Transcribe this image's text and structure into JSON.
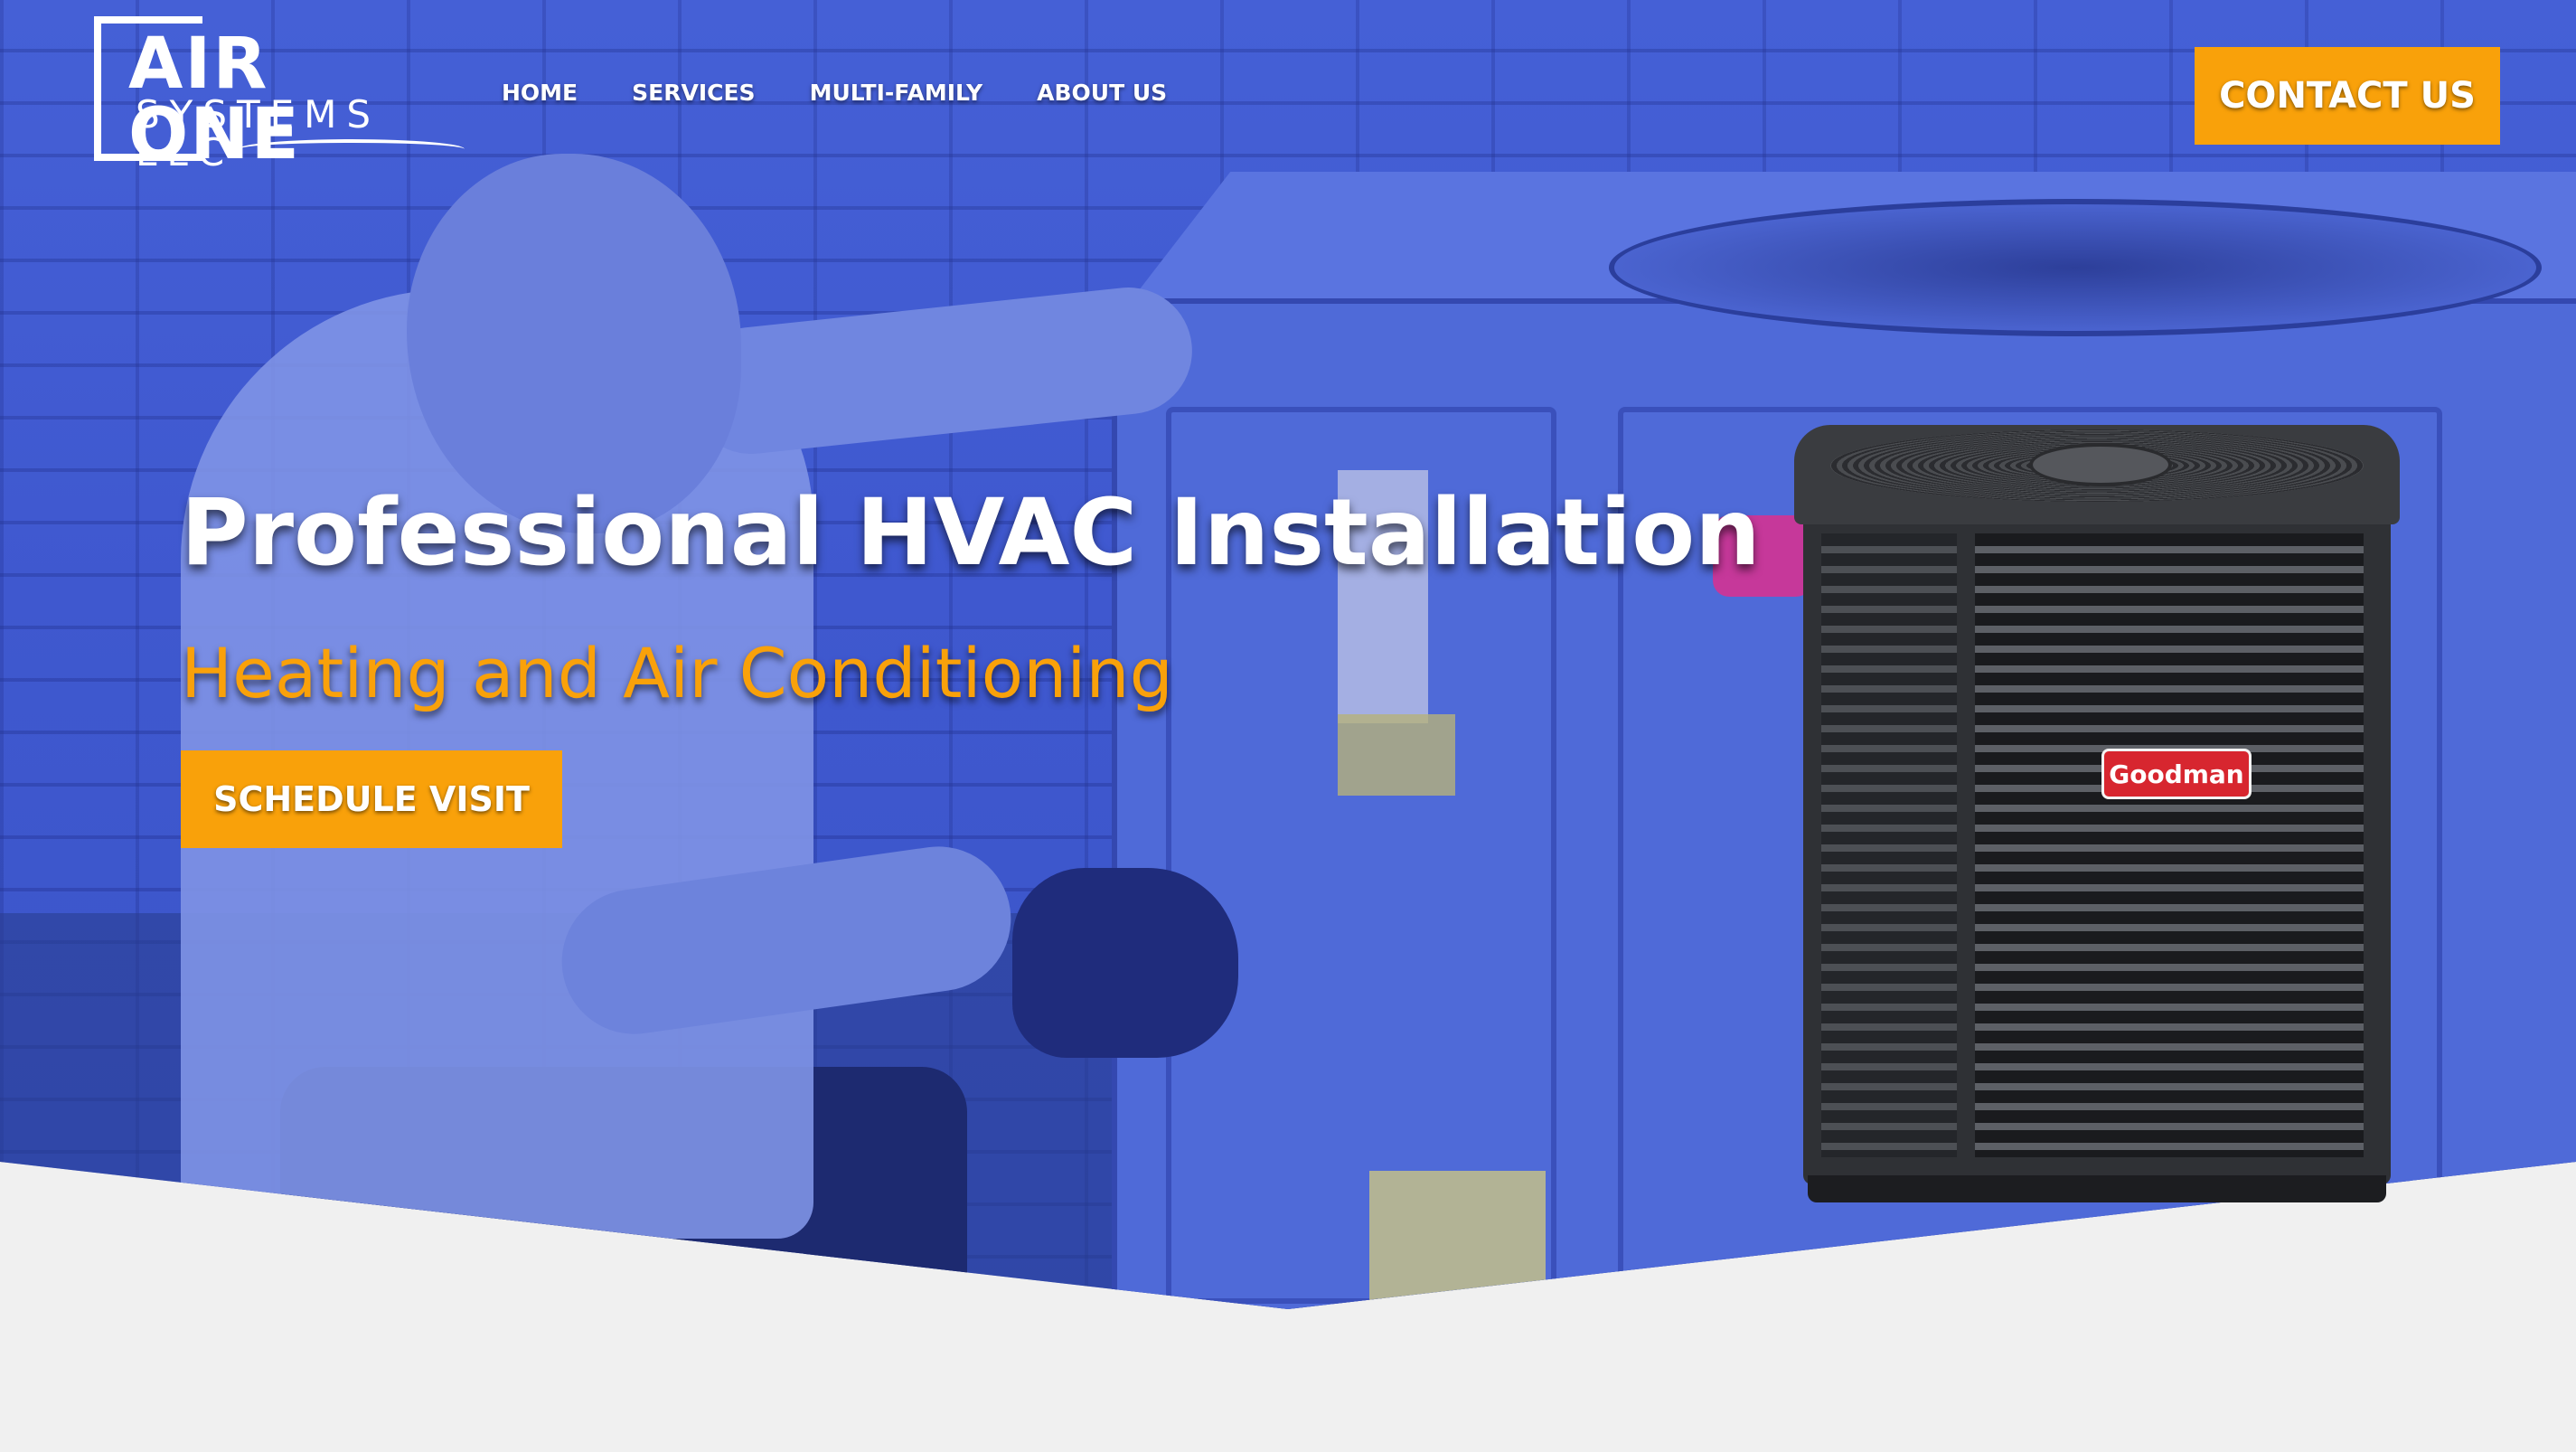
{
  "header": {
    "logo": {
      "title": "AIR ONE",
      "subtitle": "SYSTEMS LLC"
    },
    "nav": [
      {
        "label": "HOME"
      },
      {
        "label": "SERVICES"
      },
      {
        "label": "MULTI-FAMILY"
      },
      {
        "label": "ABOUT US"
      }
    ],
    "contact_button": "CONTACT US"
  },
  "hero": {
    "title": "Professional HVAC Installation",
    "subtitle": "Heating and Air Conditioning",
    "cta_button": "SCHEDULE VISIT",
    "product_brand": "Goodman"
  },
  "colors": {
    "accent": "#f9a10a",
    "overlay": "#4560d6",
    "page_bg": "#f0f0f0"
  }
}
